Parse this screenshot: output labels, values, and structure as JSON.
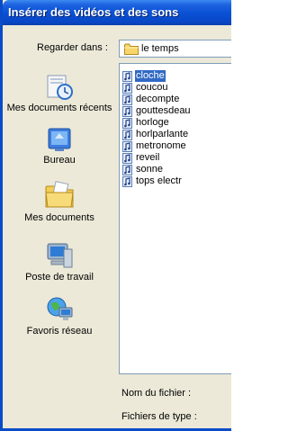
{
  "window": {
    "title": "Insérer des vidéos et des sons"
  },
  "lookin": {
    "label": "Regarder dans :",
    "value": "le temps"
  },
  "places": [
    {
      "label": "Mes documents récents",
      "icon": "recent-documents-icon"
    },
    {
      "label": "Bureau",
      "icon": "desktop-icon"
    },
    {
      "label": "Mes documents",
      "icon": "my-documents-icon"
    },
    {
      "label": "Poste de travail",
      "icon": "my-computer-icon"
    },
    {
      "label": "Favoris réseau",
      "icon": "network-places-icon"
    }
  ],
  "files": [
    {
      "name": "cloche",
      "selected": true
    },
    {
      "name": "coucou",
      "selected": false
    },
    {
      "name": "decompte",
      "selected": false
    },
    {
      "name": "gouttesdeau",
      "selected": false
    },
    {
      "name": "horloge",
      "selected": false
    },
    {
      "name": "horlparlante",
      "selected": false
    },
    {
      "name": "metronome",
      "selected": false
    },
    {
      "name": "reveil",
      "selected": false
    },
    {
      "name": "sonne",
      "selected": false
    },
    {
      "name": "tops electr",
      "selected": false
    }
  ],
  "footer": {
    "filename_label": "Nom du fichier :",
    "filetype_label": "Fichiers de type :"
  },
  "colors": {
    "titlebar": "#0A52D6",
    "dialog_bg": "#ECE9D8",
    "selection": "#316AC5"
  }
}
